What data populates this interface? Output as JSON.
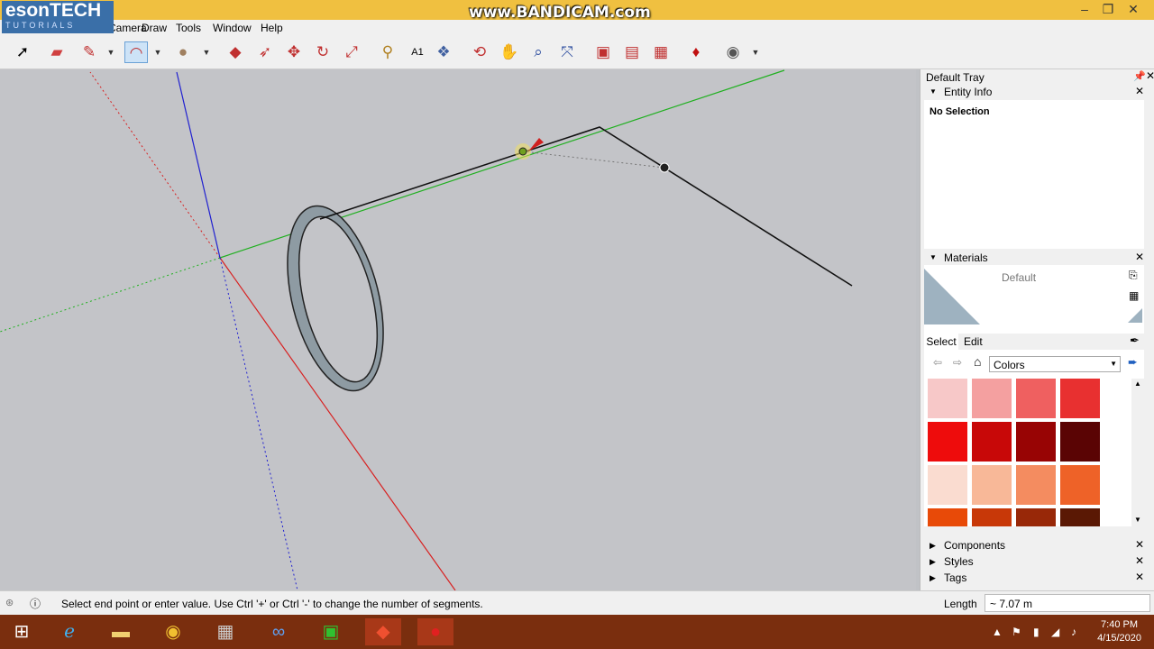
{
  "logo": {
    "line1": "esonTECH",
    "line2": "TUTORIALS"
  },
  "watermark": "www.BANDICAM.com",
  "window_controls": {
    "minimize": "–",
    "restore": "❐",
    "close": "✕"
  },
  "menu": {
    "items": [
      "Camera",
      "Draw",
      "Tools",
      "Window",
      "Help"
    ]
  },
  "toolbar": {
    "icons": [
      "select-icon",
      "eraser-icon",
      "pencil-icon",
      "arc-icon",
      "circle-icon",
      "pushpull-icon",
      "follow-me-icon",
      "move-icon",
      "rotate-icon",
      "scale-icon",
      "tape-measure-icon",
      "text-icon",
      "paint-bucket-icon",
      "orbit-icon",
      "pan-icon",
      "zoom-icon",
      "zoom-extents-icon",
      "warehouse-icon",
      "extension-warehouse-icon",
      "layout-icon",
      "ruby-icon",
      "account-icon"
    ]
  },
  "tray": {
    "title": "Default Tray",
    "entity_info": {
      "label": "Entity Info",
      "selection": "No Selection"
    },
    "materials": {
      "label": "Materials",
      "current": "Default",
      "tabs": [
        "Select",
        "Edit"
      ],
      "library": "Colors",
      "swatches": [
        "#f7c8c8",
        "#f4a0a0",
        "#ef6060",
        "#e83030",
        "#ee0c0c",
        "#c80808",
        "#980404",
        "#5a0404",
        "#fadcd0",
        "#f8b898",
        "#f48c60",
        "#ee6228",
        "#e84a08",
        "#c83808",
        "#982808",
        "#5a1804"
      ]
    },
    "collapsed": [
      "Components",
      "Styles",
      "Tags"
    ]
  },
  "status": {
    "message": "Select end point or enter value. Use Ctrl '+' or Ctrl '-' to change the number of segments.",
    "measure_label": "Length",
    "measure_value": "~ 7.07 m"
  },
  "taskbar": {
    "apps": [
      "windows-start-icon",
      "internet-explorer-icon",
      "file-explorer-icon",
      "chrome-icon",
      "calculator-icon",
      "app-icon",
      "store-icon",
      "sketchup-icon",
      "bandicam-icon"
    ],
    "time": "7:40 PM",
    "date": "4/15/2020"
  },
  "colors": {
    "titlebar": "#f0c040",
    "taskbar": "#7a2e0e",
    "axis_red": "#e02020",
    "axis_green": "#20c020",
    "axis_blue": "#2020e0"
  }
}
